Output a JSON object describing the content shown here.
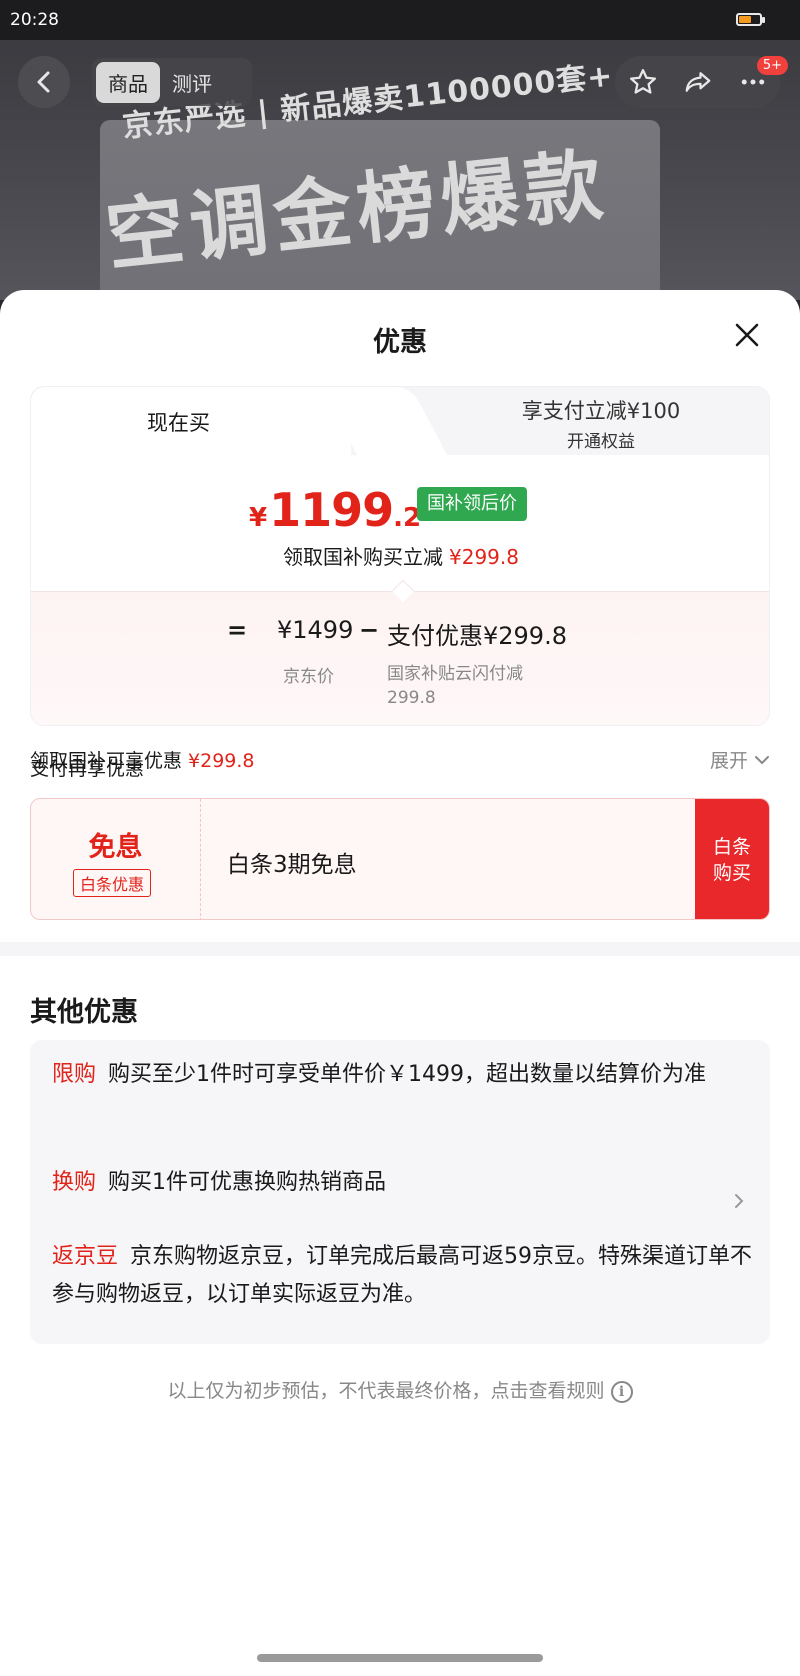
{
  "status_bar": {
    "time": "20:28",
    "battery_level": 0.6
  },
  "banner": {
    "line1": "京东严选 | 新品爆卖1100000套+",
    "line2": "空调金榜爆款"
  },
  "nav": {
    "tabs": [
      "商品",
      "测评"
    ],
    "active_tab": "商品",
    "badge": "5+"
  },
  "sheet": {
    "title": "优惠",
    "tab_now": "现在买",
    "tab_pay_main": "享支付立减¥100",
    "tab_pay_sub": "开通权益",
    "final_price": {
      "yen": "¥",
      "int": "1199",
      "dec": ".2"
    },
    "gov_tag": "国补领后价",
    "deduct_text": "领取国补购买立减",
    "deduct_amount": "¥299.8",
    "calc": {
      "eq": "=",
      "jd_price": "¥1499",
      "minus": "−",
      "pay_discount": "支付优惠¥299.8",
      "jd_label": "京东价",
      "pay_label": "国家补贴云闪付减299.8"
    },
    "gov_row_text": "领取国补可享优惠",
    "gov_row_amount": "¥299.8",
    "expand_label": "展开",
    "pay_more": "支付再享优惠",
    "baitiao": {
      "free_label": "免息",
      "tag": "白条优惠",
      "desc": "白条3期免息",
      "button": "白条购买"
    },
    "other_title": "其他优惠",
    "other_items": [
      {
        "tag": "限购",
        "text": "购买至少1件时可享受单件价￥1499，超出数量以结算价为准"
      },
      {
        "tag": "换购",
        "text": "购买1件可优惠换购热销商品"
      },
      {
        "tag": "返京豆",
        "text": "京东购物返京豆，订单完成后最高可返59京豆。特殊渠道订单不参与购物返豆，以订单实际返豆为准。"
      }
    ],
    "footer_note": "以上仅为初步预估，不代表最终价格，点击查看规则"
  },
  "colors": {
    "accent_red": "#e2231a",
    "green_tag": "#2fa84f"
  }
}
